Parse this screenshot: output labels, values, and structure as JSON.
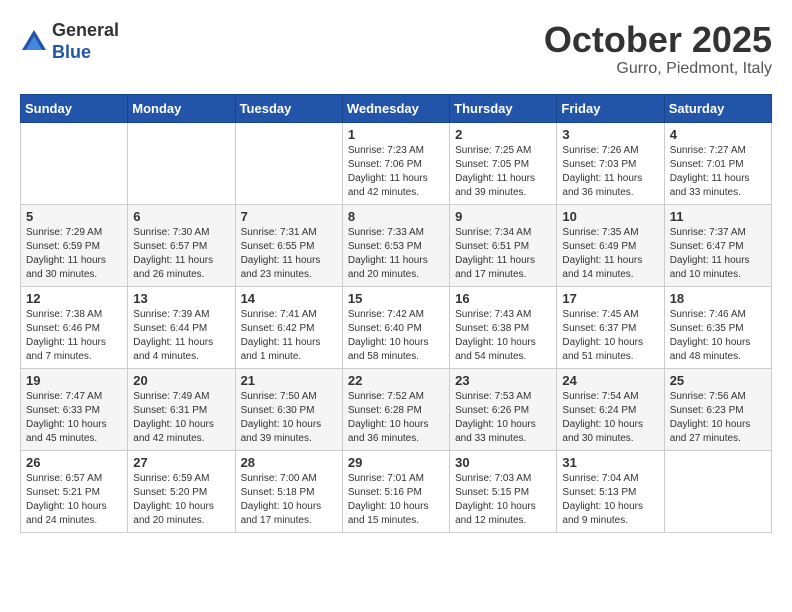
{
  "header": {
    "logo_line1": "General",
    "logo_line2": "Blue",
    "month_title": "October 2025",
    "location": "Gurro, Piedmont, Italy"
  },
  "weekdays": [
    "Sunday",
    "Monday",
    "Tuesday",
    "Wednesday",
    "Thursday",
    "Friday",
    "Saturday"
  ],
  "weeks": [
    [
      {
        "day": "",
        "info": ""
      },
      {
        "day": "",
        "info": ""
      },
      {
        "day": "",
        "info": ""
      },
      {
        "day": "1",
        "info": "Sunrise: 7:23 AM\nSunset: 7:06 PM\nDaylight: 11 hours\nand 42 minutes."
      },
      {
        "day": "2",
        "info": "Sunrise: 7:25 AM\nSunset: 7:05 PM\nDaylight: 11 hours\nand 39 minutes."
      },
      {
        "day": "3",
        "info": "Sunrise: 7:26 AM\nSunset: 7:03 PM\nDaylight: 11 hours\nand 36 minutes."
      },
      {
        "day": "4",
        "info": "Sunrise: 7:27 AM\nSunset: 7:01 PM\nDaylight: 11 hours\nand 33 minutes."
      }
    ],
    [
      {
        "day": "5",
        "info": "Sunrise: 7:29 AM\nSunset: 6:59 PM\nDaylight: 11 hours\nand 30 minutes."
      },
      {
        "day": "6",
        "info": "Sunrise: 7:30 AM\nSunset: 6:57 PM\nDaylight: 11 hours\nand 26 minutes."
      },
      {
        "day": "7",
        "info": "Sunrise: 7:31 AM\nSunset: 6:55 PM\nDaylight: 11 hours\nand 23 minutes."
      },
      {
        "day": "8",
        "info": "Sunrise: 7:33 AM\nSunset: 6:53 PM\nDaylight: 11 hours\nand 20 minutes."
      },
      {
        "day": "9",
        "info": "Sunrise: 7:34 AM\nSunset: 6:51 PM\nDaylight: 11 hours\nand 17 minutes."
      },
      {
        "day": "10",
        "info": "Sunrise: 7:35 AM\nSunset: 6:49 PM\nDaylight: 11 hours\nand 14 minutes."
      },
      {
        "day": "11",
        "info": "Sunrise: 7:37 AM\nSunset: 6:47 PM\nDaylight: 11 hours\nand 10 minutes."
      }
    ],
    [
      {
        "day": "12",
        "info": "Sunrise: 7:38 AM\nSunset: 6:46 PM\nDaylight: 11 hours\nand 7 minutes."
      },
      {
        "day": "13",
        "info": "Sunrise: 7:39 AM\nSunset: 6:44 PM\nDaylight: 11 hours\nand 4 minutes."
      },
      {
        "day": "14",
        "info": "Sunrise: 7:41 AM\nSunset: 6:42 PM\nDaylight: 11 hours\nand 1 minute."
      },
      {
        "day": "15",
        "info": "Sunrise: 7:42 AM\nSunset: 6:40 PM\nDaylight: 10 hours\nand 58 minutes."
      },
      {
        "day": "16",
        "info": "Sunrise: 7:43 AM\nSunset: 6:38 PM\nDaylight: 10 hours\nand 54 minutes."
      },
      {
        "day": "17",
        "info": "Sunrise: 7:45 AM\nSunset: 6:37 PM\nDaylight: 10 hours\nand 51 minutes."
      },
      {
        "day": "18",
        "info": "Sunrise: 7:46 AM\nSunset: 6:35 PM\nDaylight: 10 hours\nand 48 minutes."
      }
    ],
    [
      {
        "day": "19",
        "info": "Sunrise: 7:47 AM\nSunset: 6:33 PM\nDaylight: 10 hours\nand 45 minutes."
      },
      {
        "day": "20",
        "info": "Sunrise: 7:49 AM\nSunset: 6:31 PM\nDaylight: 10 hours\nand 42 minutes."
      },
      {
        "day": "21",
        "info": "Sunrise: 7:50 AM\nSunset: 6:30 PM\nDaylight: 10 hours\nand 39 minutes."
      },
      {
        "day": "22",
        "info": "Sunrise: 7:52 AM\nSunset: 6:28 PM\nDaylight: 10 hours\nand 36 minutes."
      },
      {
        "day": "23",
        "info": "Sunrise: 7:53 AM\nSunset: 6:26 PM\nDaylight: 10 hours\nand 33 minutes."
      },
      {
        "day": "24",
        "info": "Sunrise: 7:54 AM\nSunset: 6:24 PM\nDaylight: 10 hours\nand 30 minutes."
      },
      {
        "day": "25",
        "info": "Sunrise: 7:56 AM\nSunset: 6:23 PM\nDaylight: 10 hours\nand 27 minutes."
      }
    ],
    [
      {
        "day": "26",
        "info": "Sunrise: 6:57 AM\nSunset: 5:21 PM\nDaylight: 10 hours\nand 24 minutes."
      },
      {
        "day": "27",
        "info": "Sunrise: 6:59 AM\nSunset: 5:20 PM\nDaylight: 10 hours\nand 20 minutes."
      },
      {
        "day": "28",
        "info": "Sunrise: 7:00 AM\nSunset: 5:18 PM\nDaylight: 10 hours\nand 17 minutes."
      },
      {
        "day": "29",
        "info": "Sunrise: 7:01 AM\nSunset: 5:16 PM\nDaylight: 10 hours\nand 15 minutes."
      },
      {
        "day": "30",
        "info": "Sunrise: 7:03 AM\nSunset: 5:15 PM\nDaylight: 10 hours\nand 12 minutes."
      },
      {
        "day": "31",
        "info": "Sunrise: 7:04 AM\nSunset: 5:13 PM\nDaylight: 10 hours\nand 9 minutes."
      },
      {
        "day": "",
        "info": ""
      }
    ]
  ]
}
